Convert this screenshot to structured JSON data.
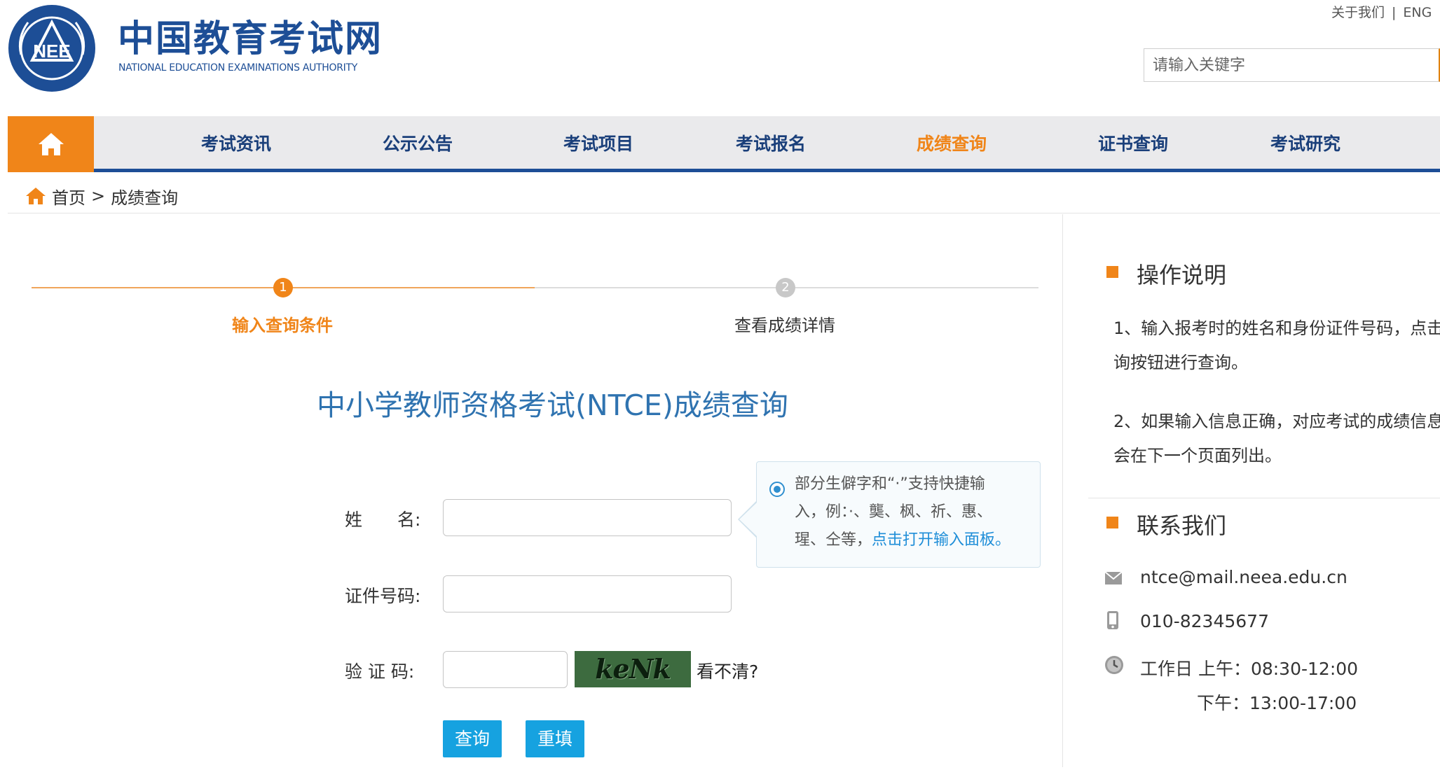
{
  "header": {
    "logo_cn": "中国教育考试网",
    "logo_en": "NATIONAL EDUCATION EXAMINATIONS AUTHORITY",
    "emblem_text": "NEE",
    "top_links": [
      "关于我们",
      "ENG"
    ],
    "top_separator": "|",
    "search_placeholder": "请输入关键字"
  },
  "nav": {
    "home_icon": "home-icon",
    "items": [
      {
        "label": "考试资讯",
        "active": false
      },
      {
        "label": "公示公告",
        "active": false
      },
      {
        "label": "考试项目",
        "active": false
      },
      {
        "label": "考试报名",
        "active": false
      },
      {
        "label": "成绩查询",
        "active": true
      },
      {
        "label": "证书查询",
        "active": false
      },
      {
        "label": "考试研究",
        "active": false
      }
    ]
  },
  "breadcrumb": {
    "home": "首页",
    "separator": ">",
    "current": "成绩查询"
  },
  "steps": [
    {
      "number": "1",
      "label": "输入查询条件",
      "active": true
    },
    {
      "number": "2",
      "label": "查看成绩详情",
      "active": false
    }
  ],
  "form": {
    "title": "中小学教师资格考试(NTCE)成绩查询",
    "name_label": "姓　　名:",
    "id_label": "证件号码:",
    "captcha_label": "验 证 码:",
    "name_value": "",
    "id_value": "",
    "captcha_value": "",
    "captcha_text": "keNk",
    "refresh_text": "看不清?",
    "submit_label": "查询",
    "reset_label": "重填"
  },
  "tooltip": {
    "line1": "部分生僻字和“·”支持快捷输",
    "line2": "入，例：·、龑、枫、祈、惠、",
    "line3_text": "瑆、仝等，",
    "line3_link": "点击打开输入面板。"
  },
  "sidebar": {
    "instructions_title": "操作说明",
    "instructions": [
      "1、输入报考时的姓名和身份证件号码，点击",
      "询按钮进行查询。",
      "2、如果输入信息正确，对应考试的成绩信息",
      "会在下一个页面列出。"
    ],
    "contact_title": "联系我们",
    "email": "ntce@mail.neea.edu.cn",
    "phone": "010-82345677",
    "hours_am": "工作日 上午：08:30-12:00",
    "hours_pm": "下午：13:00-17:00"
  },
  "colors": {
    "brand_blue": "#1d4e96",
    "accent_orange": "#f08519",
    "link_blue": "#1f8ed8",
    "button_blue": "#16a2e0"
  }
}
